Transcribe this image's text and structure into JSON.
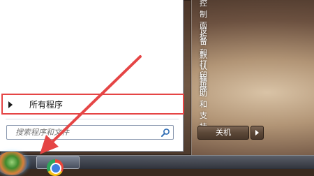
{
  "start_menu": {
    "all_programs_label": "所有程序",
    "search_placeholder": "搜索程序和文件",
    "right_items": [
      "控制面板",
      "设备和打印机",
      "默认程序",
      "帮助和支持"
    ],
    "shutdown_label": "关机"
  },
  "taskbar": {
    "icons": [
      "start-orb",
      "chrome-icon"
    ]
  },
  "colors": {
    "highlight": "#e54545",
    "annotation_arrow": "#e54545"
  }
}
